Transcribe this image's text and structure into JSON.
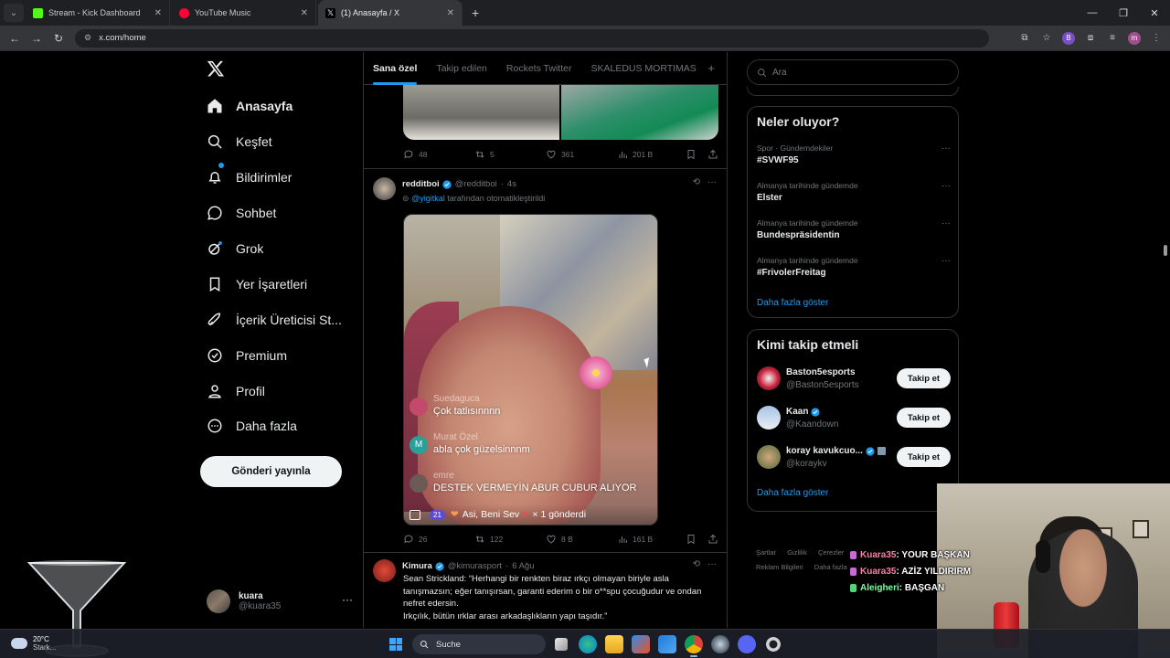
{
  "browser": {
    "tabs": [
      {
        "title": "Stream - Kick Dashboard",
        "color": "#53fc18"
      },
      {
        "title": "YouTube Music",
        "color": "#ff0033"
      },
      {
        "title": "(1) Anasayfa / X",
        "color": "#ffffff"
      }
    ],
    "url": "x.com/home",
    "extension_badge": "B",
    "profile_letter": "m"
  },
  "sidebar": {
    "items": [
      {
        "label": "Anasayfa",
        "icon": "home-icon"
      },
      {
        "label": "Keşfet",
        "icon": "search-icon"
      },
      {
        "label": "Bildirimler",
        "icon": "bell-icon"
      },
      {
        "label": "Sohbet",
        "icon": "chat-icon"
      },
      {
        "label": "Grok",
        "icon": "grok-icon"
      },
      {
        "label": "Yer İşaretleri",
        "icon": "bookmark-icon"
      },
      {
        "label": "İçerik Üreticisi St...",
        "icon": "rocket-icon"
      },
      {
        "label": "Premium",
        "icon": "premium-icon"
      },
      {
        "label": "Profil",
        "icon": "person-icon"
      },
      {
        "label": "Daha fazla",
        "icon": "more-circle-icon"
      }
    ],
    "notification_count": "1",
    "post_button": "Gönderi yayınla",
    "account": {
      "name": "kuara",
      "handle": "@kuara35",
      "more": "···"
    }
  },
  "feed": {
    "tabs": [
      "Sana özel",
      "Takip edilen",
      "Rockets Twitter",
      "SKALEDUS MORTIMAS"
    ],
    "add_tab": "+",
    "first_post_stats": {
      "replies": "48",
      "reposts": "5",
      "likes": "361",
      "views": "201 B"
    },
    "post2": {
      "name": "redditboi",
      "handle": "@redditboi",
      "time": "4s",
      "sub_link": "@yigitkal",
      "sub_text": "tarafından otomatikleştirildi",
      "video_overlay": [
        {
          "user": "Suedaguca",
          "msg": "Çok tatlısınnnn",
          "av_color": "#c44a6c"
        },
        {
          "user": "Murat Özel",
          "msg": "abla çok güzelsinnnm",
          "av_color": "#2aa198",
          "letter": "M"
        },
        {
          "user": "emre",
          "msg": "DESTEK VERMEYİN ABUR CUBUR ALIYOR",
          "av_color": "#6b5b55"
        }
      ],
      "video_bar": {
        "badge": "21",
        "text": "Asi, Beni Sev",
        "suffix": "× 1 gönderdi"
      },
      "stats": {
        "replies": "26",
        "reposts": "122",
        "likes": "8 B",
        "views": "161 B"
      }
    },
    "post3": {
      "name": "Kimura",
      "handle": "@kimurasport",
      "time": "6 Ağu",
      "text_1": "Sean Strickland: “Herhangi bir renkten biraz ırkçı olmayan biriyle asla tanışmazsın; eğer tanışırsan, garanti ederim o bir o**spu çocuğudur ve ondan nefret edersin.",
      "text_2": "Irkçılık, bütün ırklar arası arkadaşlıkların yapı taşıdır.”"
    }
  },
  "right": {
    "search_placeholder": "Ara",
    "trends_title": "Neler oluyor?",
    "trends": [
      {
        "context": "Spor · Gündemdekiler",
        "title": "#SVWF95"
      },
      {
        "context": "Almanya tarihinde gündemde",
        "title": "Elster"
      },
      {
        "context": "Almanya tarihinde gündemde",
        "title": "Bundespräsidentin"
      },
      {
        "context": "Almanya tarihinde gündemde",
        "title": "#FrivolerFreitag"
      }
    ],
    "show_more": "Daha fazla göster",
    "who_title": "Kimi takip etmeli",
    "who": [
      {
        "name": "Baston5esports",
        "handle": "@Baston5esports",
        "button": "Takip et",
        "verified": false
      },
      {
        "name": "Kaan",
        "handle": "@Kaandown",
        "button": "Takip et",
        "verified": true
      },
      {
        "name": "koray kavukcuo...",
        "handle": "@koraykv",
        "button": "Takip et",
        "verified": true
      }
    ],
    "who_more": "Daha fazla göster",
    "footer": [
      "Şartlar",
      "Gizlilik",
      "Çerezler",
      "Reklam Bilgileri",
      "Daha fazla"
    ]
  },
  "stream_chat": [
    {
      "user": "Kuara35",
      "msg": ": YOUR BAŞKAN",
      "color": "#ff7fa8"
    },
    {
      "user": "Kuara35",
      "msg": ": AZİZ YILDIRIRM",
      "color": "#ff7fa8"
    },
    {
      "user": "Aleigheri",
      "msg": ": BAŞGAN",
      "color": "#7dff9a"
    }
  ],
  "taskbar": {
    "weather_temp": "20°C",
    "weather_desc": "Stark...",
    "search_label": "Suche"
  }
}
